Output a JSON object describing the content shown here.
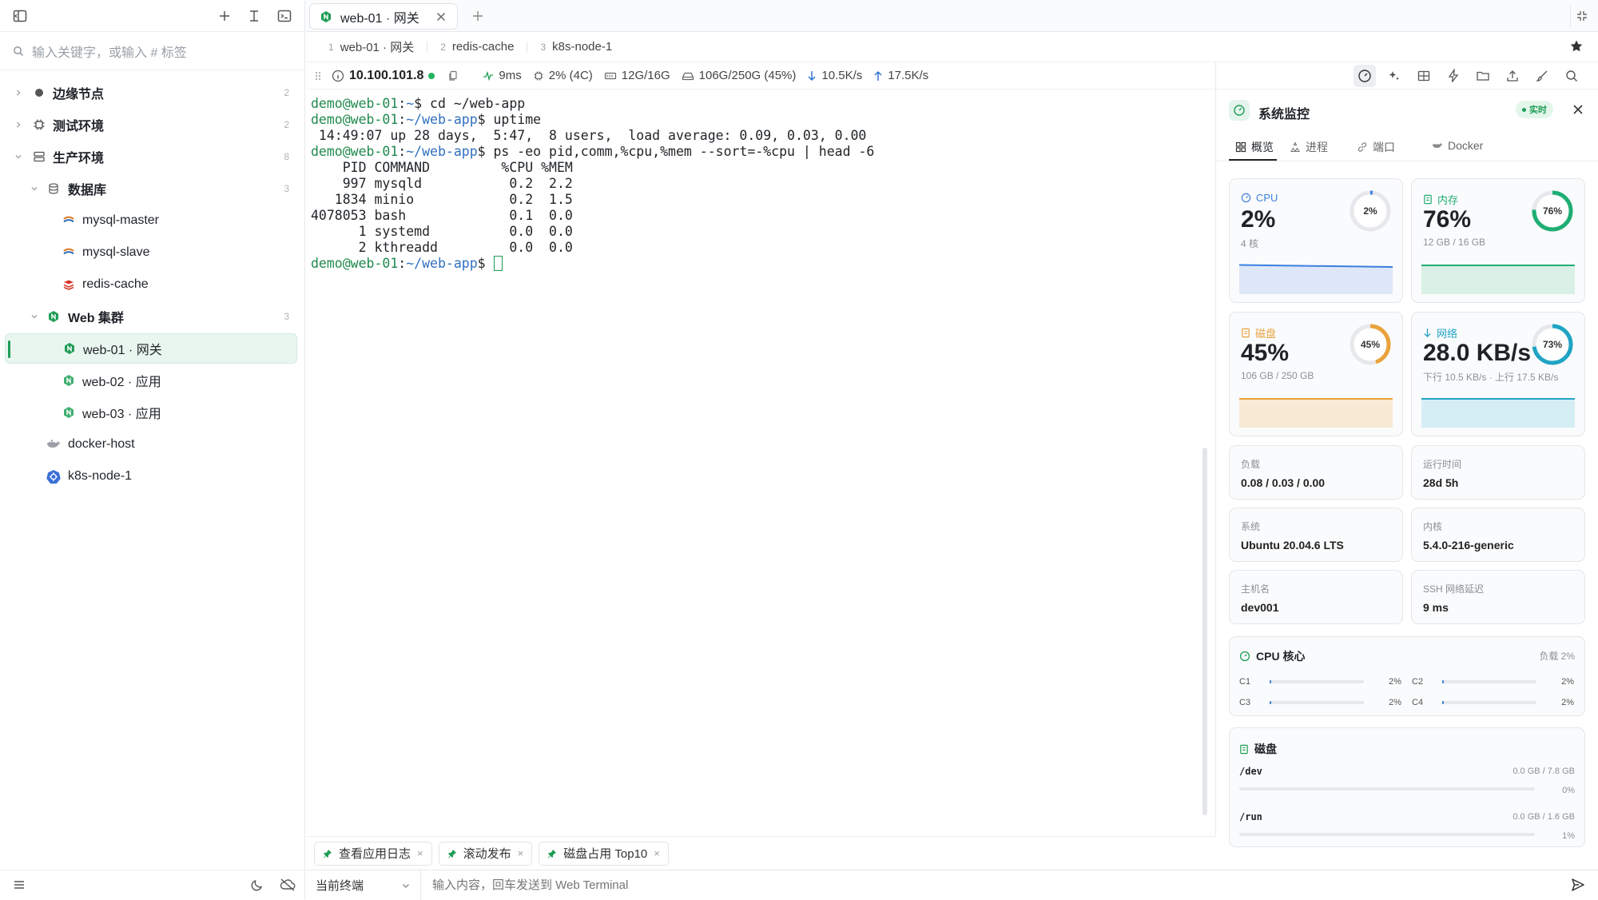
{
  "search": {
    "placeholder": "输入关键字，或输入 # 标签"
  },
  "tree": [
    {
      "label": "边缘节点",
      "count": "2"
    },
    {
      "label": "测试环境",
      "count": "2"
    },
    {
      "label": "生产环境",
      "count": "8"
    },
    {
      "label": "数据库",
      "count": "3"
    },
    {
      "label": "mysql-master"
    },
    {
      "label": "mysql-slave"
    },
    {
      "label": "redis-cache"
    },
    {
      "label": "Web 集群",
      "count": "3"
    },
    {
      "label": "web-01 · 网关"
    },
    {
      "label": "web-02 · 应用"
    },
    {
      "label": "web-03 · 应用"
    },
    {
      "label": "docker-host"
    },
    {
      "label": "k8s-node-1"
    }
  ],
  "tabs": [
    {
      "label": "web-01 · 网关"
    }
  ],
  "sessions": [
    {
      "num": "1",
      "label": "web-01 · 网关"
    },
    {
      "num": "2",
      "label": "redis-cache"
    },
    {
      "num": "3",
      "label": "k8s-node-1"
    }
  ],
  "status": {
    "ip": "10.100.101.8",
    "latency": "9ms",
    "cpu": "2% (4C)",
    "mem": "12G/16G",
    "disk": "106G/250G (45%)",
    "down": "10.5K/s",
    "up": "17.5K/s"
  },
  "terminal": {
    "lines": [
      {
        "user": "demo@web-01",
        "path": "~",
        "cmd": "cd ~/web-app"
      },
      {
        "user": "demo@web-01",
        "path": "~/web-app",
        "cmd": "uptime"
      },
      {
        "out": " 14:49:07 up 28 days,  5:47,  8 users,  load average: 0.09, 0.03, 0.00"
      },
      {
        "user": "demo@web-01",
        "path": "~/web-app",
        "cmd": "ps -eo pid,comm,%cpu,%mem --sort=-%cpu | head -6"
      },
      {
        "out": "    PID COMMAND         %CPU %MEM"
      },
      {
        "out": "    997 mysqld           0.2  2.2"
      },
      {
        "out": "   1834 minio            0.2  1.5"
      },
      {
        "out": "4078053 bash             0.1  0.0"
      },
      {
        "out": "      1 systemd          0.0  0.0"
      },
      {
        "out": "      2 kthreadd         0.0  0.0"
      }
    ],
    "last_prompt": {
      "user": "demo@web-01",
      "path": "~/web-app"
    }
  },
  "quick_commands": [
    {
      "label": "查看应用日志"
    },
    {
      "label": "滚动发布"
    },
    {
      "label": "磁盘占用 Top10"
    }
  ],
  "input": {
    "target": "当前终端",
    "placeholder": "输入内容，回车发送到 Web Terminal"
  },
  "monitor": {
    "title": "系统监控",
    "badge": "实时",
    "tabs": [
      "概览",
      "进程",
      "端口",
      "Docker"
    ],
    "cpu": {
      "label": "CPU",
      "value": "2%",
      "sub": "4 核",
      "pct": 2,
      "pct_text": "2%",
      "color": "#3b7fe0"
    },
    "mem": {
      "label": "内存",
      "value": "76%",
      "sub": "12 GB / 16 GB",
      "pct": 76,
      "pct_text": "76%",
      "color": "#1fae74"
    },
    "disk": {
      "label": "磁盘",
      "value": "45%",
      "sub": "106 GB / 250 GB",
      "pct": 45,
      "pct_text": "45%",
      "color": "#e9a23b"
    },
    "net": {
      "label": "网络",
      "value": "28.0 KB/s",
      "sub": "下行 10.5 KB/s · 上行 17.5 KB/s",
      "pct": 73,
      "pct_text": "73%",
      "color": "#20a4c4"
    },
    "info": [
      {
        "k": "负载",
        "v": "0.08 / 0.03 / 0.00"
      },
      {
        "k": "运行时间",
        "v": "28d 5h"
      },
      {
        "k": "系统",
        "v": "Ubuntu 20.04.6 LTS"
      },
      {
        "k": "内核",
        "v": "5.4.0-216-generic"
      },
      {
        "k": "主机名",
        "v": "dev001"
      },
      {
        "k": "SSH 网络延迟",
        "v": "9 ms"
      }
    ],
    "cores": {
      "title": "CPU 核心",
      "load": "负载 2%",
      "items": [
        {
          "name": "C1",
          "pct": 2,
          "text": "2%"
        },
        {
          "name": "C2",
          "pct": 2,
          "text": "2%"
        },
        {
          "name": "C3",
          "pct": 2,
          "text": "2%"
        },
        {
          "name": "C4",
          "pct": 2,
          "text": "2%"
        }
      ]
    },
    "disks": {
      "title": "磁盘",
      "items": [
        {
          "mount": "/dev",
          "size": "0.0 GB / 7.8 GB",
          "pct": "0%"
        },
        {
          "mount": "/run",
          "size": "0.0 GB / 1.6 GB",
          "pct": "1%"
        }
      ]
    }
  }
}
